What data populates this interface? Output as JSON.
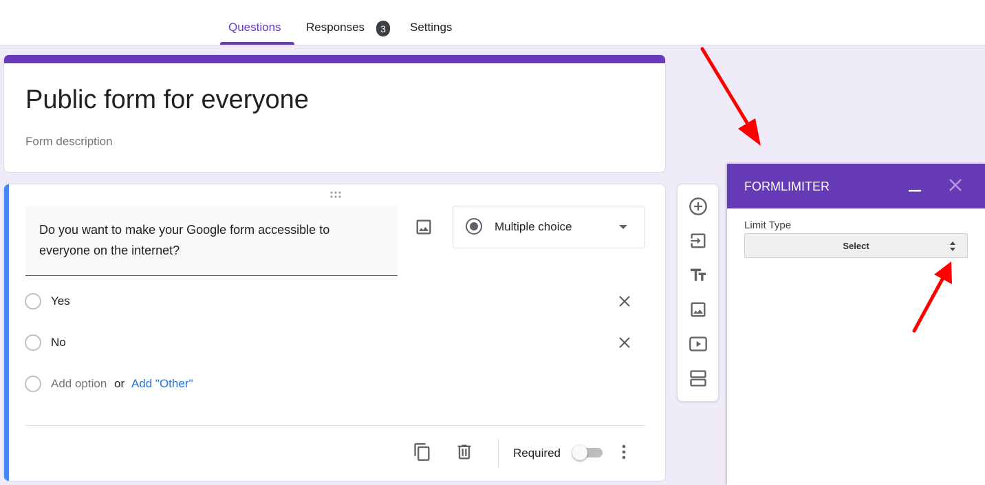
{
  "tabs": {
    "questions": "Questions",
    "responses": "Responses",
    "responses_count": "3",
    "settings": "Settings"
  },
  "form": {
    "title": "Public form for everyone",
    "description_placeholder": "Form description"
  },
  "question": {
    "text": "Do you want to make your Google form accessible to everyone  on the internet?",
    "type": "Multiple choice",
    "options": [
      "Yes",
      "No"
    ],
    "add_option": "Add option",
    "or": "or",
    "add_other": "Add \"Other\"",
    "required_label": "Required",
    "required": false
  },
  "side_toolbar": {
    "items": [
      "add-question-icon",
      "import-questions-icon",
      "add-title-icon",
      "add-image-icon",
      "add-video-icon",
      "add-section-icon"
    ]
  },
  "formlimiter": {
    "title": "FORMLIMITER",
    "limit_type_label": "Limit Type",
    "limit_type_value": "Select"
  },
  "colors": {
    "accent": "#673ab7",
    "question_accent": "#4285f4",
    "background": "#f0ebf8",
    "link": "#1a73e8",
    "annotation_arrow": "#ff0000"
  }
}
